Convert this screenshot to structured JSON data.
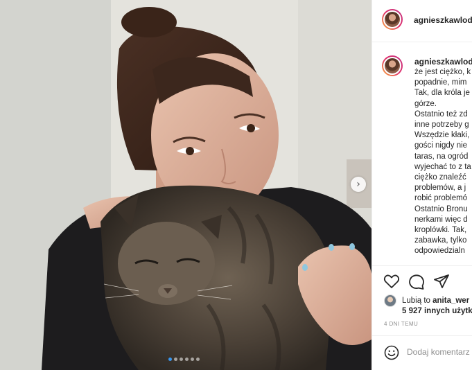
{
  "post": {
    "username": "agnieszkawloda",
    "carousel": {
      "slide_count": 6,
      "active_index": 0
    }
  },
  "caption": {
    "author": "agnieszkawloda",
    "lines": [
      "że jest ciężko, k",
      "popadnie, mim",
      "Tak, dla króla je",
      "górze.",
      "Ostatnio też zd",
      "inne potrzeby g",
      "Wszędzie kłaki,",
      "gości nigdy nie",
      "taras, na ogród",
      "wyjechać to z ta",
      "ciężko znaleźć",
      "problemów, a j",
      "robić problemó",
      "Ostatnio Bronu",
      "nerkami więc d",
      "kroplówki. Tak,",
      "zabawka, tylko",
      "odpowiedzialn"
    ]
  },
  "likes": {
    "prefix": "Lubią to ",
    "user": "anita_wer",
    "others": "5 927 innych użytk"
  },
  "timestamp": "4 DNI TEMU",
  "comment": {
    "placeholder": "Dodaj komentarz"
  },
  "icons": {
    "next": "chevron-right",
    "like": "heart-outline",
    "comment": "speech-bubble",
    "share": "paper-plane",
    "emoji": "smiley"
  },
  "colors": {
    "active_dot": "#3897f0",
    "meta_text": "#8e8e8e",
    "border": "#efefef"
  }
}
